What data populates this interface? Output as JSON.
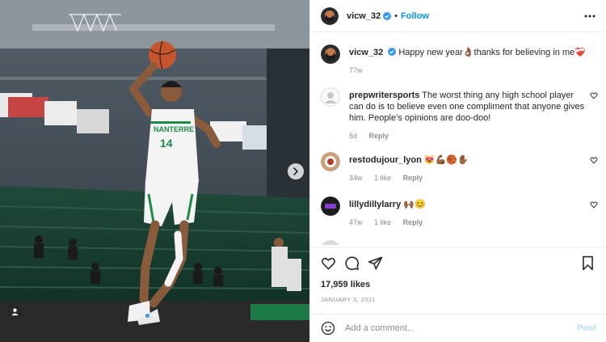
{
  "post": {
    "author": "vicw_32",
    "follow_label": "Follow",
    "separator": "•",
    "caption_text": "Happy new year👌🏾thanks for believing in me❤️‍🩹",
    "caption_age": "77w",
    "likes": "17,959 likes",
    "date": "JANUARY 3, 2021"
  },
  "comments": [
    {
      "username": "prepwritersports",
      "text": "The worst thing any high school player can do is to believe even one compliment that anyone gives him. People’s opinions are doo-doo!",
      "age": "6d",
      "likes": "",
      "reply_label": "Reply"
    },
    {
      "username": "restodujour_lyon",
      "text": "😻💪🏾🏀✋🏾",
      "age": "34w",
      "likes": "1 like",
      "reply_label": "Reply"
    },
    {
      "username": "lillydillylarry",
      "text": "🙌🏾😊",
      "age": "47w",
      "likes": "1 like",
      "reply_label": "Reply"
    }
  ],
  "composer": {
    "placeholder": "Add a comment...",
    "post_label": "Post"
  },
  "photo": {
    "jersey_text": "NANTERRE",
    "jersey_number": "14"
  },
  "colors": {
    "link_blue": "#0095f6",
    "verified_blue": "#3897f0",
    "post_disabled": "#b2dffc",
    "jersey_green": "#1e8a4a"
  },
  "icons": [
    "more-icon",
    "like-icon",
    "comment-icon",
    "share-icon",
    "save-icon",
    "emoji-icon",
    "user-tag-icon",
    "chevron-right-icon",
    "verified-icon"
  ]
}
